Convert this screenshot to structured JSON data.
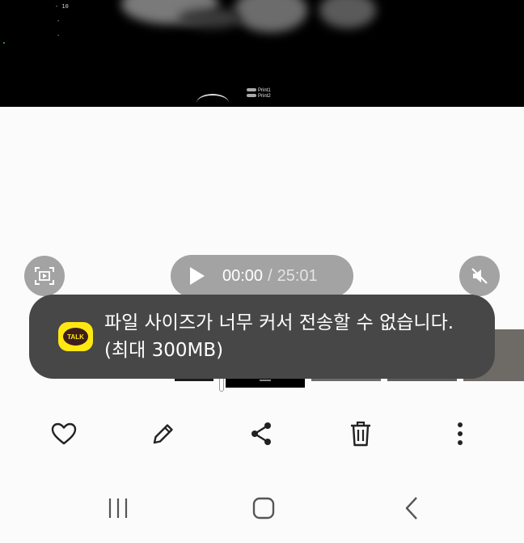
{
  "video": {
    "scale_top": "- 10",
    "print_labels": [
      "Print1",
      "Print2"
    ]
  },
  "player": {
    "current_time": "00:00",
    "separator": "/",
    "total_time": "25:01"
  },
  "toast": {
    "app_icon_text": "TALK",
    "message": "파일 사이즈가 너무 커서 전송할 수 없습니다. (최대 300MB)"
  },
  "icons": {
    "capture": "screen-capture-icon",
    "play": "play-icon",
    "mute": "mute-icon",
    "favorite": "heart-icon",
    "edit": "pencil-icon",
    "share": "share-icon",
    "delete": "trash-icon",
    "more": "more-vertical-icon",
    "recents": "recents-icon",
    "home": "home-icon",
    "back": "back-icon"
  },
  "colors": {
    "overlay_button": "#a3a3a3",
    "toast_background": "#474747",
    "kakao_yellow": "#ffe812",
    "kakao_brown": "#3c1e1e"
  }
}
